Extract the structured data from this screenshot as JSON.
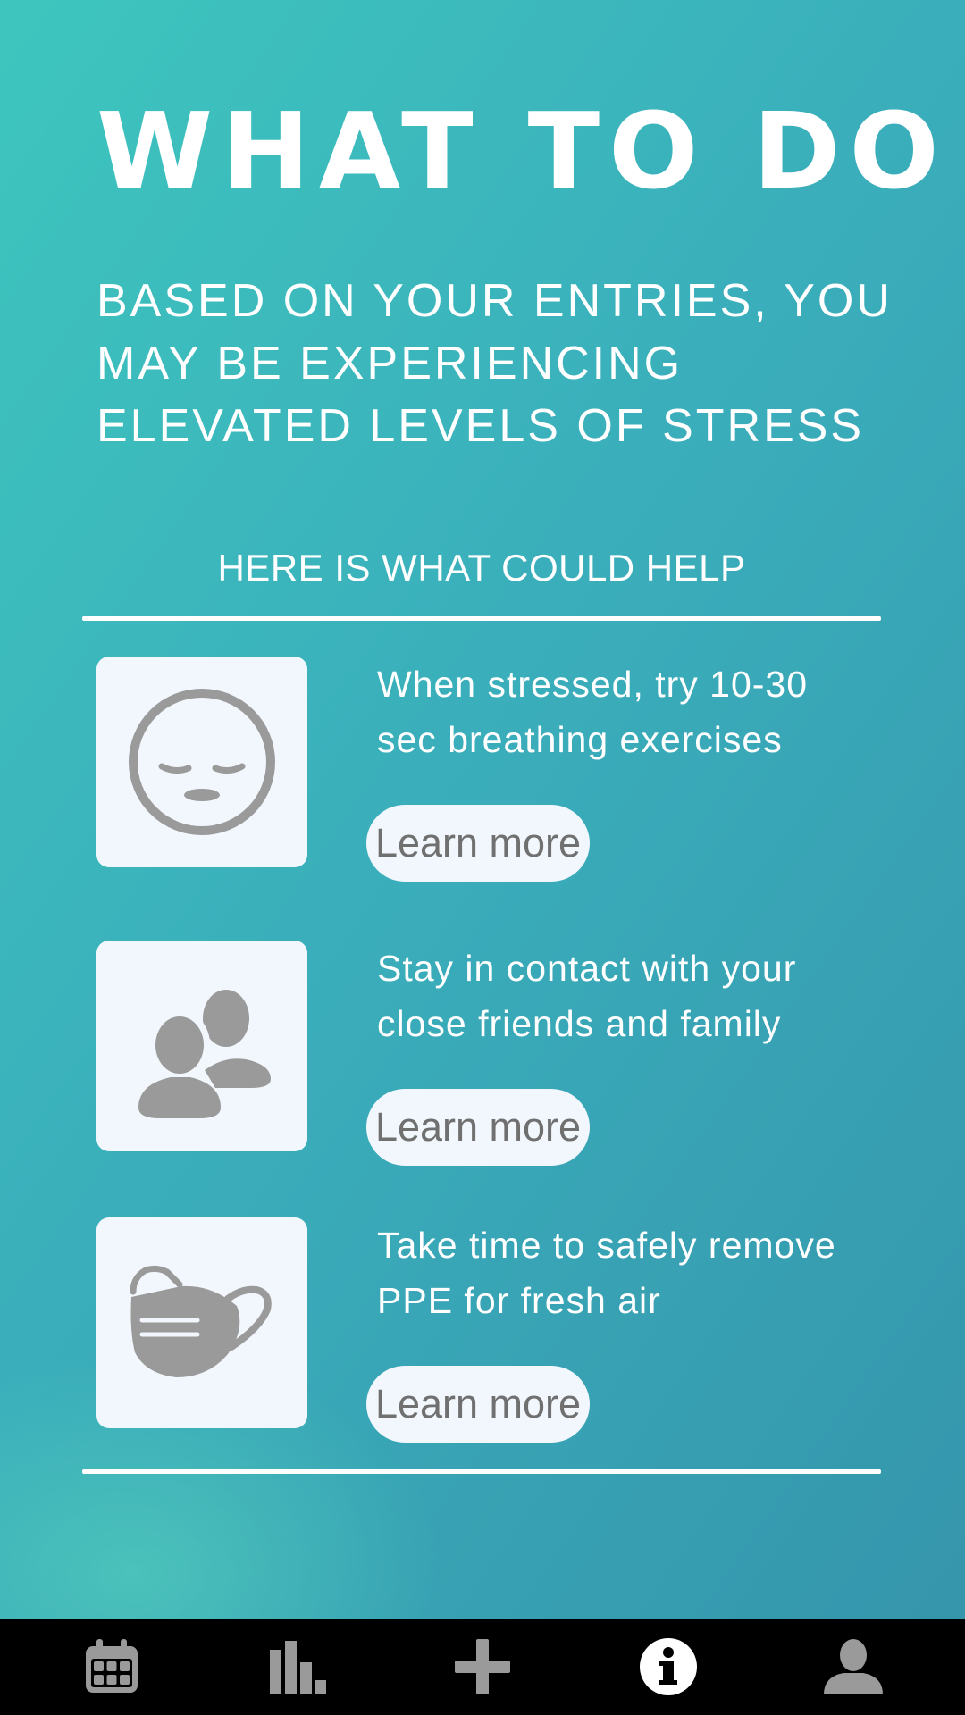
{
  "header": {
    "title": "WHAT TO DO",
    "subtitle": "BASED ON YOUR ENTRIES, YOU MAY BE EXPERIENCING ELEVATED LEVELS OF STRESS"
  },
  "help": {
    "heading": "HERE IS WHAT COULD HELP"
  },
  "tips": [
    {
      "icon": "sleepy-face-icon",
      "text": "When stressed, try 10-30 sec breathing exercises",
      "button_label": "Learn more"
    },
    {
      "icon": "people-icon",
      "text": "Stay in contact with your close friends and family",
      "button_label": "Learn more"
    },
    {
      "icon": "face-mask-icon",
      "text": "Take time to safely remove PPE for fresh air",
      "button_label": "Learn more"
    }
  ],
  "nav": {
    "items": [
      {
        "icon": "calendar-icon",
        "active": false
      },
      {
        "icon": "bar-chart-icon",
        "active": false
      },
      {
        "icon": "plus-icon",
        "active": false
      },
      {
        "icon": "info-icon",
        "active": true
      },
      {
        "icon": "user-icon",
        "active": false
      }
    ]
  },
  "colors": {
    "gradient_start": "#3ec6be",
    "gradient_end": "#3594ab",
    "card_background": "#f1f7fd",
    "icon_gray": "#9a9a9a",
    "button_text": "#707070",
    "nav_background": "#000000",
    "nav_icon_inactive": "#9a9a9a",
    "nav_icon_active": "#ffffff"
  }
}
